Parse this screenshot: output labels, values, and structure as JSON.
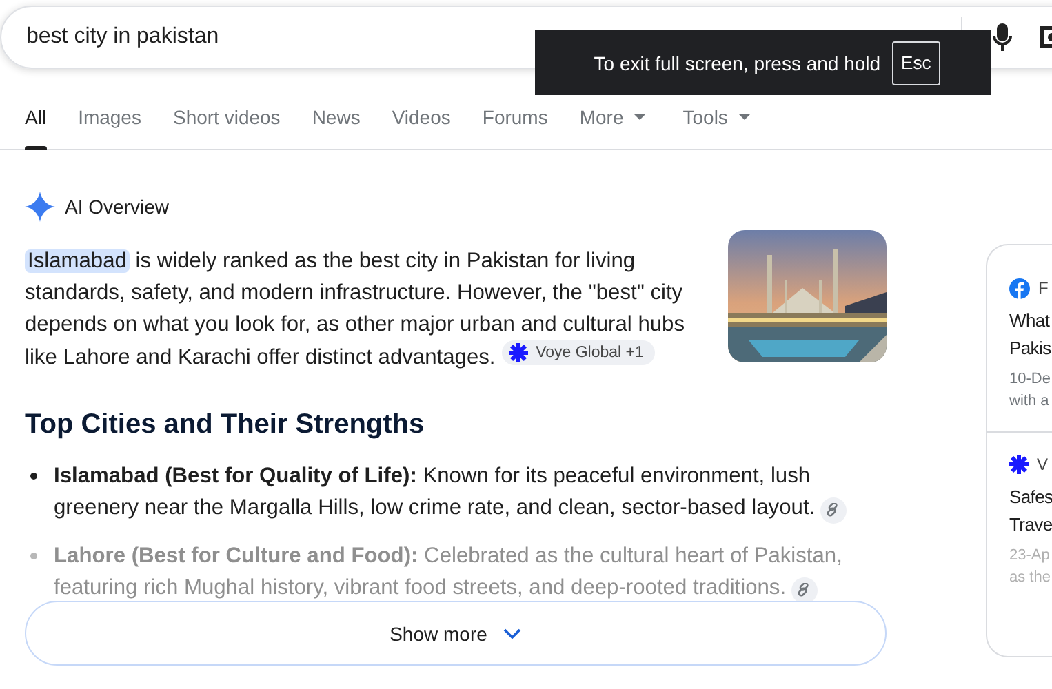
{
  "search": {
    "value": "best city in pakistan"
  },
  "toast": {
    "text": "To exit full screen, press and hold",
    "key": "Esc"
  },
  "tabs": [
    {
      "label": "All",
      "selected": true,
      "dropdown": false
    },
    {
      "label": "Images",
      "selected": false,
      "dropdown": false
    },
    {
      "label": "Short videos",
      "selected": false,
      "dropdown": false
    },
    {
      "label": "News",
      "selected": false,
      "dropdown": false
    },
    {
      "label": "Videos",
      "selected": false,
      "dropdown": false
    },
    {
      "label": "Forums",
      "selected": false,
      "dropdown": false
    },
    {
      "label": "More",
      "selected": false,
      "dropdown": true
    },
    {
      "label": "Tools",
      "selected": false,
      "dropdown": true
    }
  ],
  "ai_overview": {
    "title": "AI Overview",
    "highlight": "Islamabad",
    "summary": "is widely ranked as the best city in Pakistan for living standards, safety, and modern infrastructure. However, the \"best\" city depends on what you look for, as other major urban and cultural hubs like Lahore and Karachi offer distinct advantages.",
    "citation": "Voye Global +1",
    "heading": "Top Cities and Their Strengths",
    "items": [
      {
        "text": "**Islamabad (Best for Quality of Life):** Known for its peaceful environment, lush greenery near the Margalla Hills, low crime rate, and clean, sector-based layout.",
        "faded": false
      },
      {
        "text": "**Lahore (Best for Culture and Food):** Celebrated as the cultural heart of Pakistan, featuring rich Mughal history, vibrant food streets, and deep-rooted traditions.",
        "faded": true
      }
    ],
    "show_more": "Show more"
  },
  "sources": [
    {
      "kind": "facebook",
      "site": "F",
      "title": [
        "What",
        "Pakis"
      ],
      "meta": [
        "10-De",
        "with a"
      ]
    },
    {
      "kind": "burst",
      "site": "V",
      "title": [
        "Safes",
        "Trave"
      ],
      "meta": [
        "23-Ap",
        "as the"
      ]
    }
  ]
}
